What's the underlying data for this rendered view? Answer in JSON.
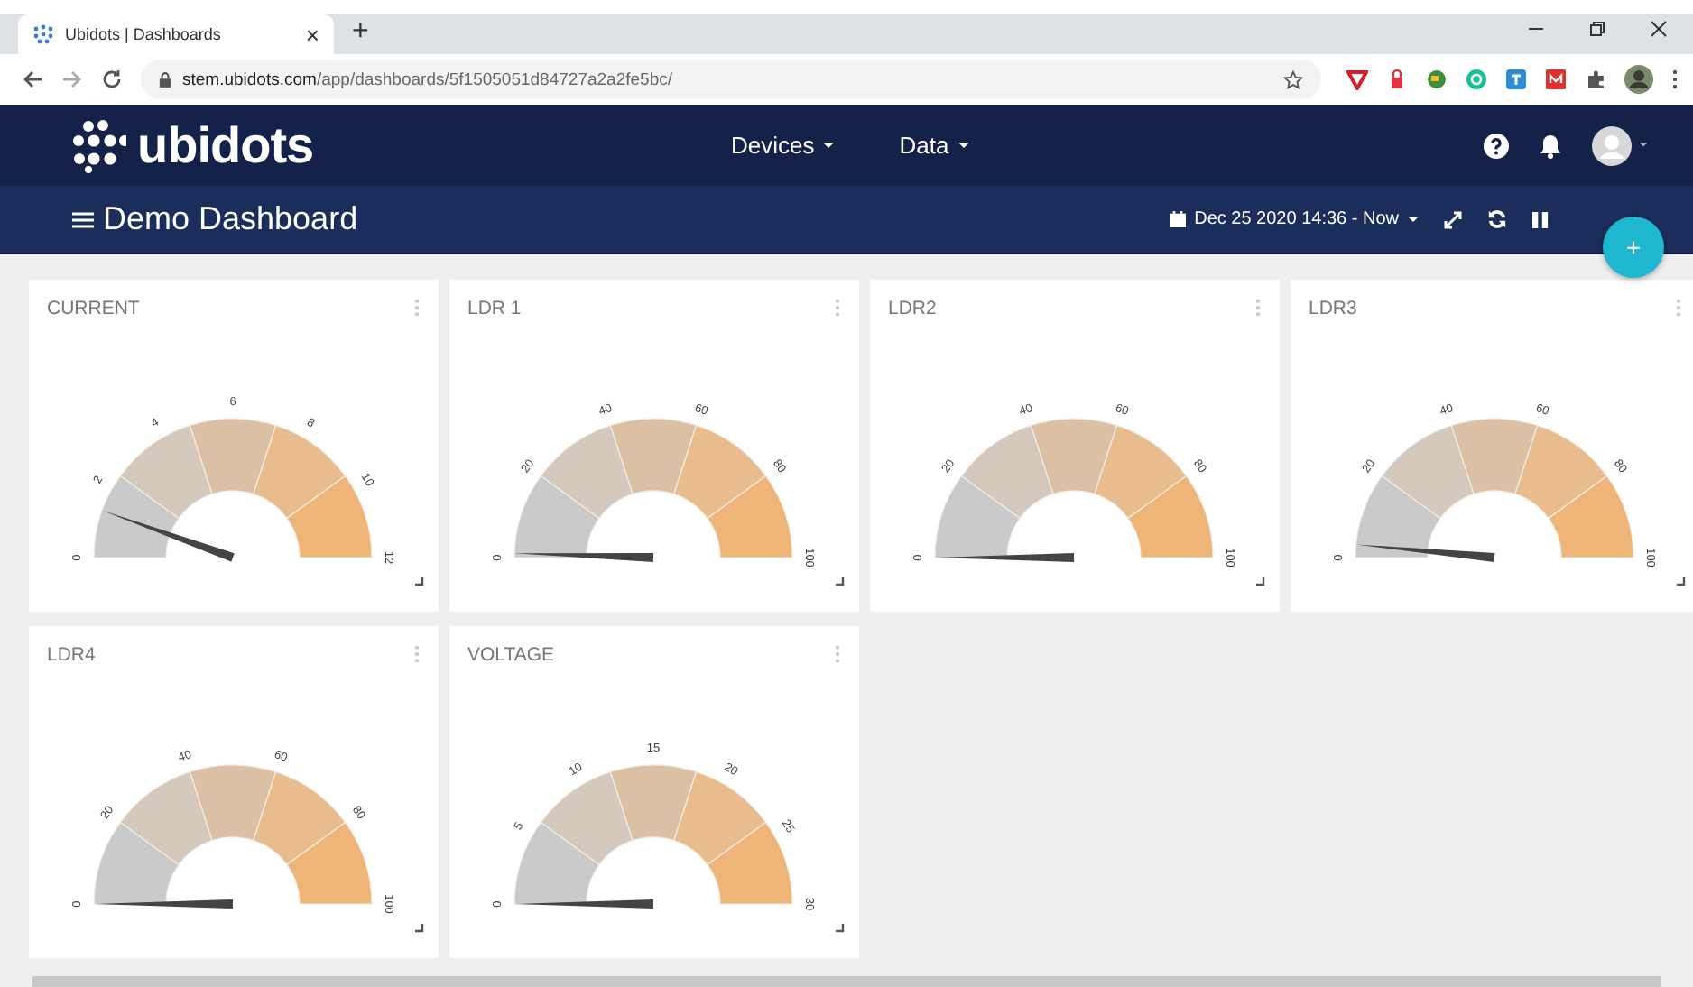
{
  "browser": {
    "tab_title": "Ubidots | Dashboards",
    "tab_close": "×",
    "new_tab": "+",
    "url_host": "stem.ubidots.com",
    "url_path": "/app/dashboards/5f1505051d84727a2a2fe5bc/"
  },
  "navbar": {
    "logo": "ubidots",
    "menus": [
      "Devices",
      "Data"
    ]
  },
  "dashboard_bar": {
    "title": "Demo Dashboard",
    "date_range": "Dec 25 2020 14:36 - Now"
  },
  "fab": "+",
  "widgets": [
    {
      "title": "CURRENT",
      "ticks": [
        "0",
        "2",
        "4",
        "6",
        "8",
        "10",
        "12"
      ]
    },
    {
      "title": "LDR 1",
      "ticks": [
        "0",
        "20",
        "40",
        "60",
        "80",
        "100"
      ]
    },
    {
      "title": "LDR2",
      "ticks": [
        "0",
        "20",
        "40",
        "60",
        "80",
        "100"
      ]
    },
    {
      "title": "LDR3",
      "ticks": [
        "0",
        "20",
        "40",
        "60",
        "80",
        "100"
      ]
    },
    {
      "title": "LDR4",
      "ticks": [
        "0",
        "20",
        "40",
        "60",
        "80",
        "100"
      ]
    },
    {
      "title": "VOLTAGE",
      "ticks": [
        "0",
        "5",
        "10",
        "15",
        "20",
        "25",
        "30"
      ]
    }
  ]
}
